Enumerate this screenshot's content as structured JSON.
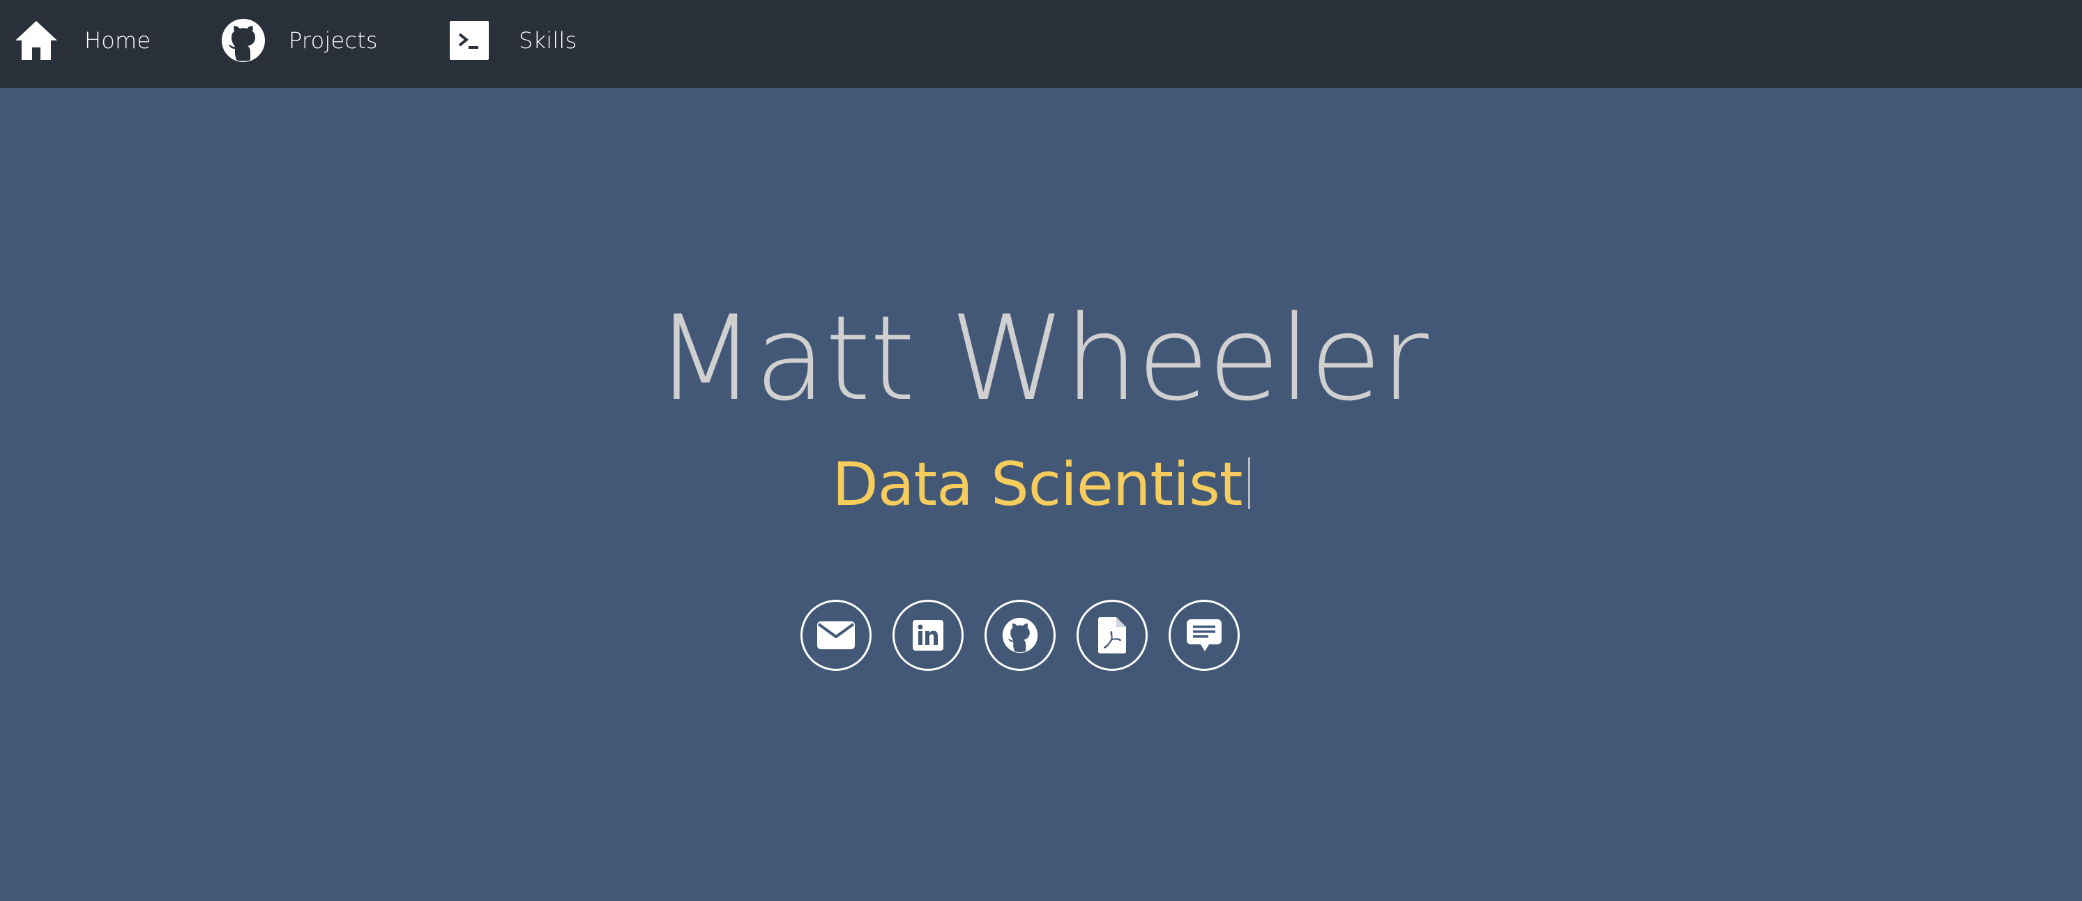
{
  "nav": {
    "items": [
      {
        "label": "Home",
        "icon": "home-icon"
      },
      {
        "label": "Projects",
        "icon": "github-icon"
      },
      {
        "label": "Skills",
        "icon": "terminal-icon"
      }
    ]
  },
  "hero": {
    "name": "Matt Wheeler",
    "role": "Data Scientist"
  },
  "social": [
    {
      "icon": "envelope-icon"
    },
    {
      "icon": "linkedin-icon"
    },
    {
      "icon": "github-icon"
    },
    {
      "icon": "pdf-file-icon"
    },
    {
      "icon": "chat-icon"
    }
  ],
  "colors": {
    "navbar": "#293039",
    "background": "#435877",
    "name": "#d0d0d0",
    "role": "#f6cd5c",
    "icon": "#ffffff"
  }
}
